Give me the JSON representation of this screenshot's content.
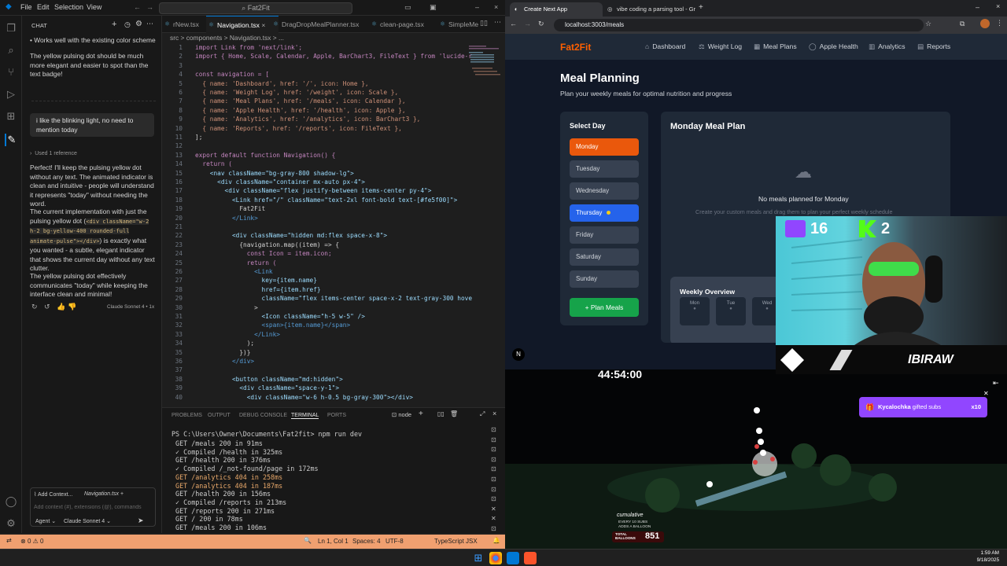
{
  "vscode": {
    "menu": [
      "File",
      "Edit",
      "Selection",
      "View"
    ],
    "command_center": "Fat2Fit",
    "chat": {
      "title": "CHAT",
      "msg0": "Works well with the existing color scheme",
      "msg1": "The yellow pulsing dot should be much more elegant and easier to spot than the text badge!",
      "user_msg": "i like the blinking light, no need to mention today",
      "used_ref": "Used 1 reference",
      "resp1": "Perfect! I'll keep the pulsing yellow dot without any text. The animated indicator is clean and intuitive - people will understand it represents \"today\" without needing the word.",
      "resp2_a": "The current implementation with just the pulsing yellow dot (",
      "resp2_code": "<div className=\"w-2 h-2 bg-yellow-400 rounded-full animate-pulse\"></div>",
      "resp2_b": ") is exactly what you wanted - a subtle, elegant indicator that shows the current day without any text clutter.",
      "resp3": "The yellow pulsing dot effectively communicates \"today\" while keeping the interface clean and minimal!",
      "model_tag": "Claude Sonnet 4 • 1x",
      "add_context": "Add Context...",
      "context_file": "Navigation.tsx",
      "input_placeholder": "Add context (#), extensions (@), commands",
      "mode": "Agent",
      "model": "Claude Sonnet 4"
    },
    "tabs": [
      "rNew.tsx",
      "Navigation.tsx",
      "DragDropMealPlanner.tsx",
      "clean-page.tsx",
      "SimpleMe"
    ],
    "breadcrumb": "src > components > Navigation.tsx > ...",
    "code_lines": [
      {
        "n": "1",
        "t": "import Link from 'next/link';"
      },
      {
        "n": "2",
        "t": "import { Home, Scale, Calendar, Apple, BarChart3, FileText } from 'lucide-r"
      },
      {
        "n": "3",
        "t": ""
      },
      {
        "n": "4",
        "t": "const navigation = ["
      },
      {
        "n": "5",
        "t": "  { name: 'Dashboard', href: '/', icon: Home },"
      },
      {
        "n": "6",
        "t": "  { name: 'Weight Log', href: '/weight', icon: Scale },"
      },
      {
        "n": "7",
        "t": "  { name: 'Meal Plans', href: '/meals', icon: Calendar },"
      },
      {
        "n": "8",
        "t": "  { name: 'Apple Health', href: '/health', icon: Apple },"
      },
      {
        "n": "9",
        "t": "  { name: 'Analytics', href: '/analytics', icon: BarChart3 },"
      },
      {
        "n": "10",
        "t": "  { name: 'Reports', href: '/reports', icon: FileText },"
      },
      {
        "n": "11",
        "t": "];"
      },
      {
        "n": "12",
        "t": ""
      },
      {
        "n": "13",
        "t": "export default function Navigation() {"
      },
      {
        "n": "14",
        "t": "  return ("
      },
      {
        "n": "15",
        "t": "    <nav className=\"bg-gray-800 shadow-lg\">"
      },
      {
        "n": "16",
        "t": "      <div className=\"container mx-auto px-4\">"
      },
      {
        "n": "17",
        "t": "        <div className=\"flex justify-between items-center py-4\">"
      },
      {
        "n": "18",
        "t": "          <Link href=\"/\" className=\"text-2xl font-bold text-[#fe5f00]\">"
      },
      {
        "n": "19",
        "t": "            Fat2Fit"
      },
      {
        "n": "20",
        "t": "          </Link>"
      },
      {
        "n": "21",
        "t": ""
      },
      {
        "n": "22",
        "t": "          <div className=\"hidden md:flex space-x-8\">"
      },
      {
        "n": "23",
        "t": "            {navigation.map((item) => {"
      },
      {
        "n": "24",
        "t": "              const Icon = item.icon;"
      },
      {
        "n": "25",
        "t": "              return ("
      },
      {
        "n": "26",
        "t": "                <Link"
      },
      {
        "n": "27",
        "t": "                  key={item.name}"
      },
      {
        "n": "28",
        "t": "                  href={item.href}"
      },
      {
        "n": "29",
        "t": "                  className=\"flex items-center space-x-2 text-gray-300 hove"
      },
      {
        "n": "30",
        "t": "                >"
      },
      {
        "n": "31",
        "t": "                  <Icon className=\"h-5 w-5\" />"
      },
      {
        "n": "32",
        "t": "                  <span>{item.name}</span>"
      },
      {
        "n": "33",
        "t": "                </Link>"
      },
      {
        "n": "34",
        "t": "              );"
      },
      {
        "n": "35",
        "t": "            })}"
      },
      {
        "n": "36",
        "t": "          </div>"
      },
      {
        "n": "37",
        "t": ""
      },
      {
        "n": "38",
        "t": "          <button className=\"md:hidden\">"
      },
      {
        "n": "39",
        "t": "            <div className=\"space-y-1\">"
      },
      {
        "n": "40",
        "t": "              <div className=\"w-6 h-0.5 bg-gray-300\"></div>"
      }
    ],
    "panel": {
      "tabs": [
        "PROBLEMS",
        "OUTPUT",
        "DEBUG CONSOLE",
        "TERMINAL",
        "PORTS"
      ],
      "shell": "node",
      "prompt": "PS C:\\Users\\Owner\\Documents\\Fat2fit> npm run dev",
      "lines": [
        " GET /meals 200 in 91ms",
        " ✓ Compiled /health in 325ms",
        " GET /health 200 in 376ms",
        " ✓ Compiled /_not-found/page in 172ms",
        " GET /analytics 404 in 258ms",
        " GET /analytics 404 in 187ms",
        " GET /health 200 in 156ms",
        " ✓ Compiled /reports in 213ms",
        " GET /reports 200 in 271ms",
        " GET / 200 in 78ms",
        " GET /meals 200 in 106ms"
      ]
    },
    "status": {
      "errors": "0",
      "warnings": "0",
      "cursor": "Ln 1, Col 1",
      "spaces": "Spaces: 4",
      "encoding": "UTF-8",
      "lang": "TypeScript JSX"
    }
  },
  "browser": {
    "tabs": [
      "Create Next App",
      "vibe coding a parsing tool - Gr"
    ],
    "url": "localhost:3003/meals",
    "app": {
      "brand": "Fat2Fit",
      "nav": [
        "Dashboard",
        "Weight Log",
        "Meal Plans",
        "Apple Health",
        "Analytics",
        "Reports"
      ],
      "title": "Meal Planning",
      "subtitle": "Plan your weekly meals for optimal nutrition and progress",
      "select_day": "Select Day",
      "days": [
        "Monday",
        "Tuesday",
        "Wednesday",
        "Thursday",
        "Friday",
        "Saturday",
        "Sunday"
      ],
      "plan_button": "Plan Meals",
      "meal_plan_title": "Monday Meal Plan",
      "empty_title": "No meals planned for Monday",
      "empty_sub": "Create your custom meals and drag them to plan your perfect weekly schedule",
      "weekly_title": "Weekly Overview",
      "week_days": [
        "Mon",
        "Tue",
        "Wed"
      ],
      "corner_badge": "N"
    }
  },
  "stream": {
    "twitch_count": "16",
    "kick_count": "2",
    "streamer": "IBIRAW",
    "timer": "44:54:00",
    "gifted_user": "Kycalochka",
    "gifted_text": "gifted subs",
    "gifted_count": "x10",
    "cumulative": "cumulative",
    "cum_line1": "EVERY 10 SUBS",
    "cum_line2": "ADDS A BALLOON",
    "total_label": "TOTAL BALLOONS",
    "total_value": "851"
  },
  "taskbar": {
    "time": "1:59 AM",
    "date": "9/18/2025"
  }
}
